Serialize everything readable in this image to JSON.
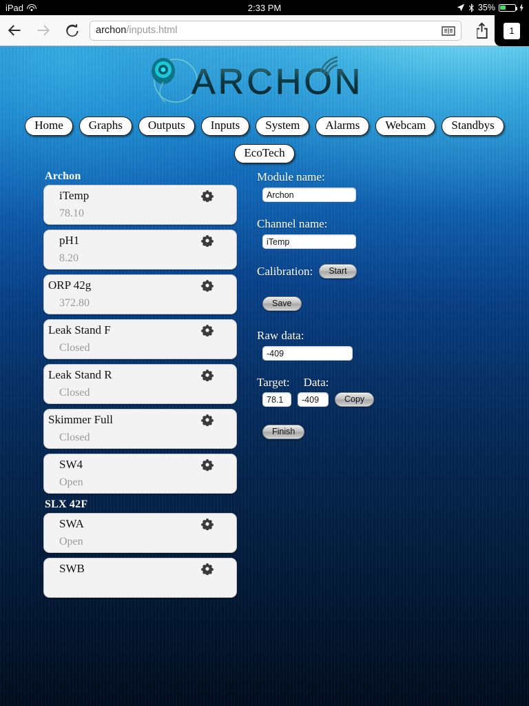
{
  "status_bar": {
    "device": "iPad",
    "wifi_icon": "wifi-icon",
    "time": "2:33 PM",
    "location_icon": "location-arrow-icon",
    "bluetooth_icon": "bluetooth-icon",
    "battery_percent": "35%",
    "battery_icon": "battery-icon",
    "charging_icon": "lightning-bolt-icon"
  },
  "browser": {
    "back_icon": "back-arrow-icon",
    "forward_icon": "forward-arrow-icon",
    "reload_icon": "reload-icon",
    "url_host": "archon",
    "url_path": "/inputs.html",
    "reader_icon": "reader-book-icon",
    "share_icon": "share-icon",
    "bookmark_icon": "bookmark-star-icon",
    "tab_count": "1"
  },
  "site": {
    "logo_text": "ARCHON",
    "logo_mark": "archon-orb-icon",
    "logo_signal": "wifi-signal-icon"
  },
  "nav": {
    "row1": [
      {
        "label": "Home"
      },
      {
        "label": "Graphs"
      },
      {
        "label": "Outputs"
      },
      {
        "label": "Inputs"
      },
      {
        "label": "System"
      },
      {
        "label": "Alarms"
      },
      {
        "label": "Webcam"
      },
      {
        "label": "Standbys"
      }
    ],
    "row2": [
      {
        "label": "EcoTech"
      }
    ]
  },
  "channel_list": {
    "groups": [
      {
        "header": "Archon",
        "items": [
          {
            "name": "iTemp",
            "value": "78.10",
            "indent": true,
            "gear_icon": "gear-icon"
          },
          {
            "name": "pH1",
            "value": "8.20",
            "indent": true,
            "gear_icon": "gear-icon"
          },
          {
            "name": "ORP 42g",
            "value": "372.80",
            "indent": false,
            "gear_icon": "gear-icon"
          },
          {
            "name": "Leak Stand F",
            "value": "Closed",
            "indent": false,
            "gear_icon": "gear-icon"
          },
          {
            "name": "Leak Stand R",
            "value": "Closed",
            "indent": false,
            "gear_icon": "gear-icon"
          },
          {
            "name": "Skimmer Full",
            "value": "Closed",
            "indent": false,
            "gear_icon": "gear-icon"
          },
          {
            "name": "SW4",
            "value": "Open",
            "indent": true,
            "gear_icon": "gear-icon"
          }
        ]
      },
      {
        "header": "SLX 42F",
        "items": [
          {
            "name": "SWA",
            "value": "Open",
            "indent": true,
            "gear_icon": "gear-icon"
          },
          {
            "name": "SWB",
            "value": "",
            "indent": true,
            "gear_icon": "gear-icon"
          }
        ]
      }
    ]
  },
  "form": {
    "module_name_label": "Module name:",
    "module_name_value": "Archon",
    "channel_name_label": "Channel name:",
    "channel_name_value": "iTemp",
    "calibration_label": "Calibration:",
    "start_button": "Start",
    "save_button": "Save",
    "raw_data_label": "Raw data:",
    "raw_data_value": "-409",
    "target_label": "Target:",
    "data_label": "Data:",
    "target_value": "78.1",
    "data_value": "-409",
    "copy_button": "Copy",
    "finish_button": "Finish"
  },
  "colors": {
    "ocean_top": "#1f7fc4",
    "ocean_bottom": "#010c1c",
    "card_bg": "#f3f3f3",
    "value_text": "#9a9a9a",
    "battery_green": "#4cd964"
  }
}
